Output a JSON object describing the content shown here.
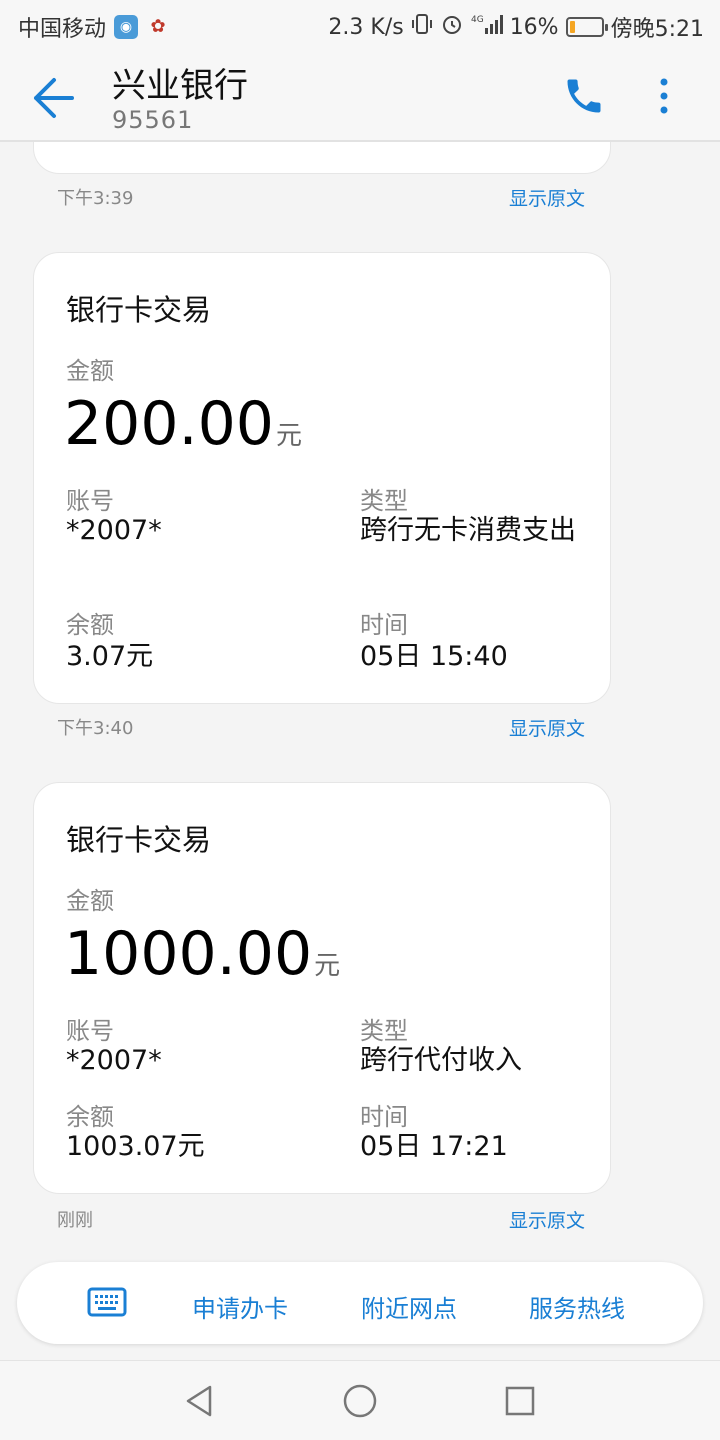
{
  "status_bar": {
    "carrier": "中国移动",
    "speed": "2.3 K/s",
    "network": "4G",
    "battery_percent_text": "16%",
    "battery_level": 0.16,
    "time": "傍晚5:21"
  },
  "header": {
    "title": "兴业银行",
    "number": "95561"
  },
  "messages": [
    {
      "time": "下午3:39",
      "show_original": "显示原文"
    },
    {
      "title": "银行卡交易",
      "amount_label": "金额",
      "amount": "200.00",
      "amount_unit": "元",
      "account_label": "账号",
      "account": "*2007*",
      "type_label": "类型",
      "type": "跨行无卡消费支出",
      "balance_label": "余额",
      "balance": "3.07元",
      "time_label": "时间",
      "time_value": "05日 15:40",
      "time": "下午3:40",
      "show_original": "显示原文"
    },
    {
      "title": "银行卡交易",
      "amount_label": "金额",
      "amount": "1000.00",
      "amount_unit": "元",
      "account_label": "账号",
      "account": "*2007*",
      "type_label": "类型",
      "type": "跨行代付收入",
      "balance_label": "余额",
      "balance": "1003.07元",
      "time_label": "时间",
      "time_value": "05日 17:21",
      "time": "刚刚",
      "show_original": "显示原文"
    }
  ],
  "actions": {
    "apply_card": "申请办卡",
    "nearby_branch": "附近网点",
    "service_hotline": "服务热线"
  },
  "colors": {
    "accent": "#1a7fd4",
    "battery_fill": "#f5a623"
  }
}
